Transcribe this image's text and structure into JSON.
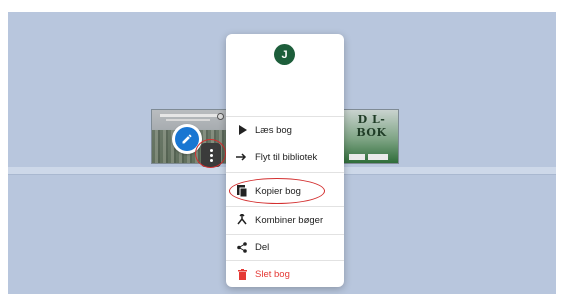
{
  "avatar": {
    "initial": "J",
    "color": "#1d5e3b"
  },
  "book_right": {
    "title": "D L-BOK"
  },
  "menu": {
    "items": [
      {
        "label": "Læs bog",
        "icon": "play-icon"
      },
      {
        "label": "Flyt til bibliotek",
        "icon": "arrow-right-icon"
      },
      {
        "label": "Kopier bog",
        "icon": "copy-icon"
      },
      {
        "label": "Kombiner bøger",
        "icon": "merge-icon"
      },
      {
        "label": "Del",
        "icon": "share-icon"
      },
      {
        "label": "Slet bog",
        "icon": "trash-icon",
        "color": "#e53935"
      }
    ]
  },
  "colors": {
    "background": "#b8c6dd",
    "accent": "#1976d2",
    "highlight": "#d32f2f"
  }
}
